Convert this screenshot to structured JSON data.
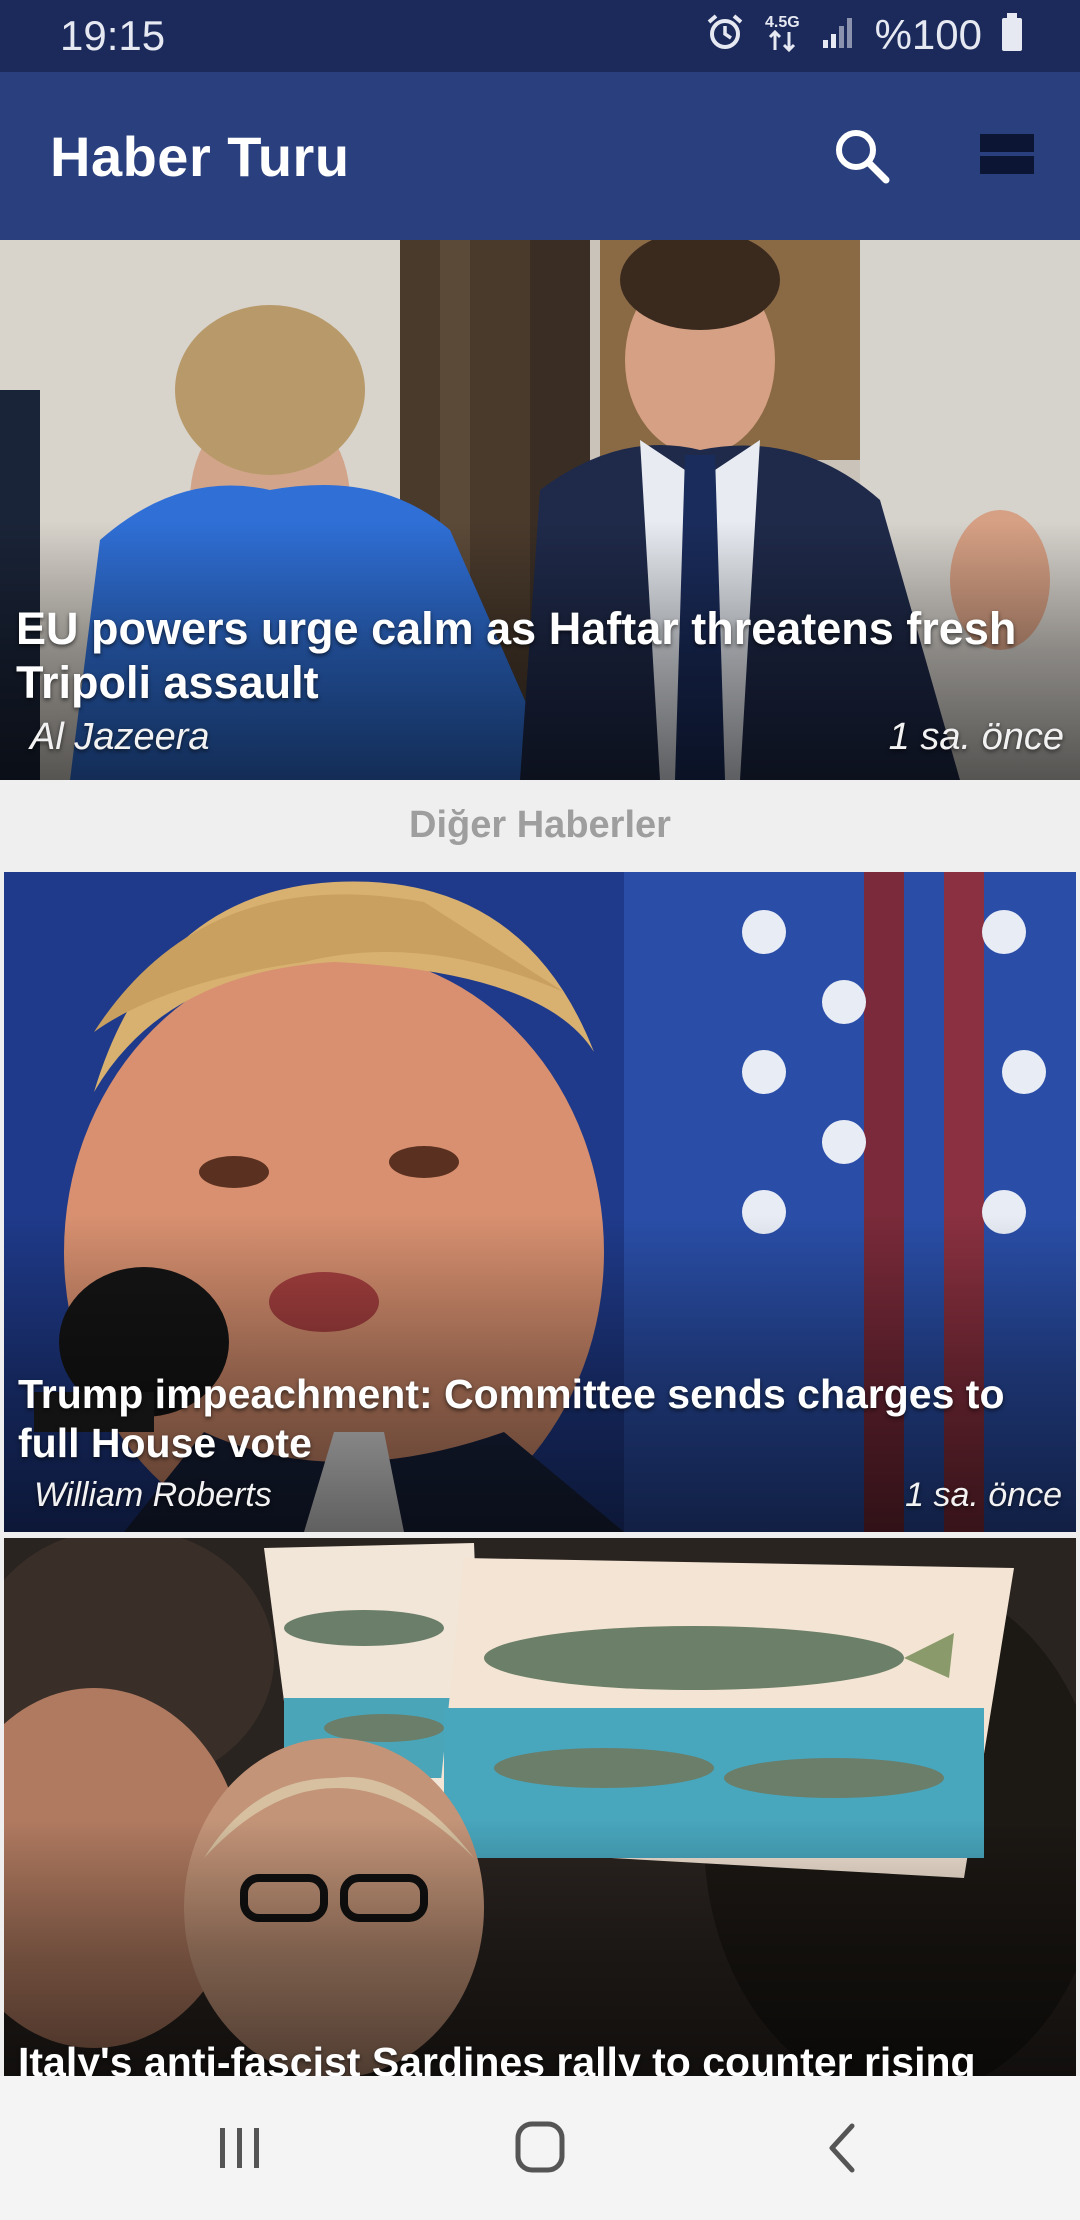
{
  "status_bar": {
    "time": "19:15",
    "network": "4.5G",
    "battery": "%100",
    "icons": [
      "alarm-icon",
      "network-data-icon",
      "signal-icon",
      "battery-icon"
    ]
  },
  "app_bar": {
    "title": "Haber Turu",
    "background": "#2a3f7d",
    "icons": [
      "search-icon",
      "menu-icon"
    ]
  },
  "featured": {
    "title": "EU powers urge calm as Haftar threatens fresh Tripoli assault",
    "source": "Al Jazeera",
    "time": "1 sa. önce"
  },
  "section": {
    "title": "Diğer Haberler"
  },
  "stories": [
    {
      "title": "Trump impeachment: Committee sends charges to full House vote",
      "source": "William Roberts",
      "time": "1 sa. önce"
    },
    {
      "title": "Italy's anti-fascist Sardines rally to counter rising"
    }
  ],
  "nav_bar": {
    "icons": [
      "recent-apps-icon",
      "home-icon",
      "back-icon"
    ]
  }
}
